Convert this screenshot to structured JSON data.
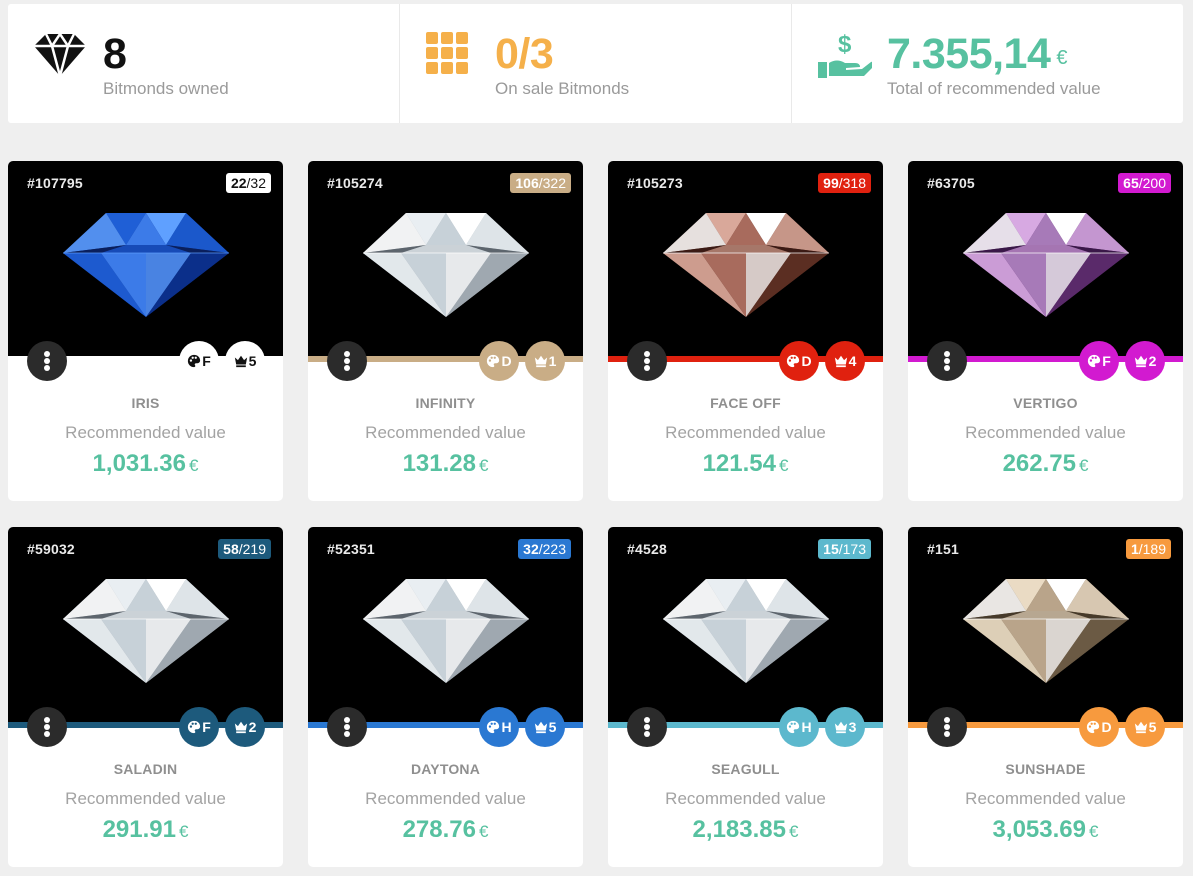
{
  "stats": {
    "owned": {
      "value": "8",
      "label": "Bitmonds owned",
      "icon": "diamond-icon"
    },
    "on_sale": {
      "value": "0/3",
      "label": "On sale Bitmonds",
      "icon": "grid-icon"
    },
    "total": {
      "value": "7.355,14",
      "currency": "€",
      "label": "Total of recommended value",
      "icon": "hand-money-icon"
    }
  },
  "colors": {
    "teal": "#57c1a0",
    "orange": "#f5b04a",
    "dark": "#111111"
  },
  "common": {
    "recommended_label": "Recommended value",
    "currency": "€",
    "color_icon": "palette-icon",
    "rank_icon": "crown-icon",
    "menu_icon": "dots-vertical-icon"
  },
  "cards": [
    {
      "id": "#107795",
      "edition_num": "22",
      "edition_total": "/32",
      "name": "IRIS",
      "value": "1,031.36",
      "color_grade": "F",
      "rank": "5",
      "accent": "#ffffff",
      "accent_text": "#111111",
      "gem": "blue"
    },
    {
      "id": "#105274",
      "edition_num": "106",
      "edition_total": "/322",
      "name": "INFINITY",
      "value": "131.28",
      "color_grade": "D",
      "rank": "1",
      "accent": "#c9ad86",
      "accent_text": "#ffffff",
      "gem": "white"
    },
    {
      "id": "#105273",
      "edition_num": "99",
      "edition_total": "/318",
      "name": "FACE OFF",
      "value": "121.54",
      "color_grade": "D",
      "rank": "4",
      "accent": "#e0210f",
      "accent_text": "#ffffff",
      "gem": "brown"
    },
    {
      "id": "#63705",
      "edition_num": "65",
      "edition_total": "/200",
      "name": "VERTIGO",
      "value": "262.75",
      "color_grade": "F",
      "rank": "2",
      "accent": "#d21ad0",
      "accent_text": "#ffffff",
      "gem": "pink"
    },
    {
      "id": "#59032",
      "edition_num": "58",
      "edition_total": "/219",
      "name": "SALADIN",
      "value": "291.91",
      "color_grade": "F",
      "rank": "2",
      "accent": "#1d5a7c",
      "accent_text": "#ffffff",
      "gem": "white"
    },
    {
      "id": "#52351",
      "edition_num": "32",
      "edition_total": "/223",
      "name": "DAYTONA",
      "value": "278.76",
      "color_grade": "H",
      "rank": "5",
      "accent": "#2a78d2",
      "accent_text": "#ffffff",
      "gem": "white"
    },
    {
      "id": "#4528",
      "edition_num": "15",
      "edition_total": "/173",
      "name": "SEAGULL",
      "value": "2,183.85",
      "color_grade": "H",
      "rank": "3",
      "accent": "#5cb8cd",
      "accent_text": "#ffffff",
      "gem": "white"
    },
    {
      "id": "#151",
      "edition_num": "1",
      "edition_total": "/189",
      "name": "SUNSHADE",
      "value": "3,053.69",
      "color_grade": "D",
      "rank": "5",
      "accent": "#f79a3e",
      "accent_text": "#ffffff",
      "gem": "champagne"
    }
  ]
}
